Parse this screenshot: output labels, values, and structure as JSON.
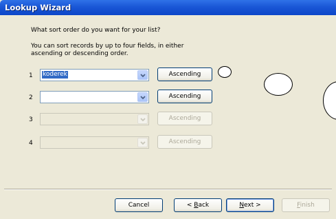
{
  "window": {
    "title": "Lookup Wizard"
  },
  "question": "What sort order do you want for your list?",
  "description": "You can sort records by up to four fields, in either ascending or descending order.",
  "rows": [
    {
      "number": "1",
      "field_value": "koderek",
      "enabled": true,
      "sort_label": "Ascending"
    },
    {
      "number": "2",
      "field_value": "",
      "enabled": true,
      "sort_label": "Ascending"
    },
    {
      "number": "3",
      "field_value": "",
      "enabled": false,
      "sort_label": "Ascending"
    },
    {
      "number": "4",
      "field_value": "",
      "enabled": false,
      "sort_label": "Ascending"
    }
  ],
  "footer": {
    "cancel_label": "Cancel",
    "back_label": "< Back",
    "back_mnemonic": "B",
    "next_label": "Next >",
    "next_mnemonic": "N",
    "finish_label": "Finish",
    "finish_mnemonic": "F"
  },
  "colors": {
    "title_bar": "#0c46c8",
    "dialog_background": "#ece9d8",
    "selection": "#316ac5",
    "button_border": "#003c74"
  }
}
